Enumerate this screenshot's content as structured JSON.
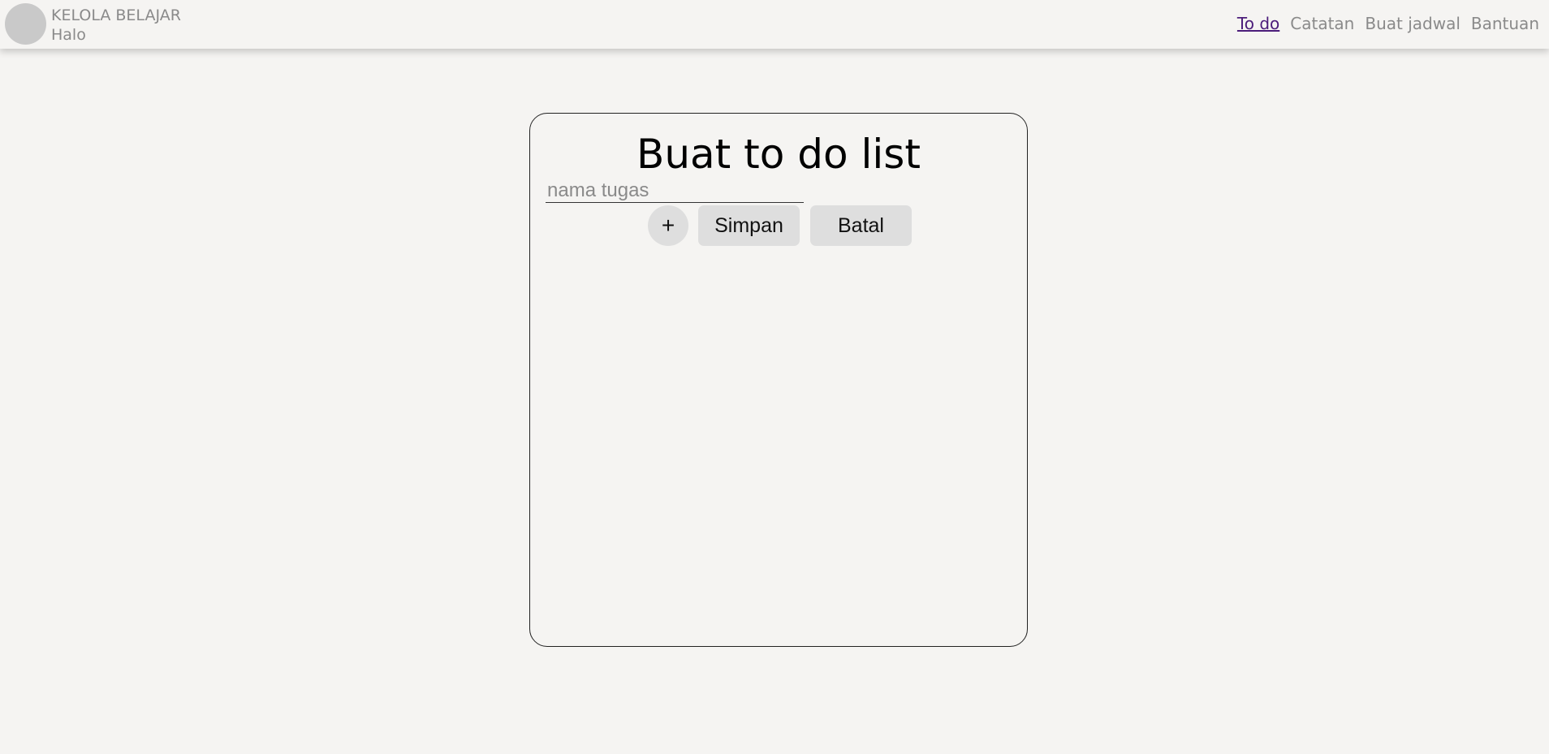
{
  "header": {
    "brand_title": "KELOLA BELAJAR",
    "greeting": "Halo",
    "nav": [
      {
        "label": "To do",
        "active": true
      },
      {
        "label": "Catatan",
        "active": false
      },
      {
        "label": "Buat jadwal",
        "active": false
      },
      {
        "label": "Bantuan",
        "active": false
      }
    ]
  },
  "todo_card": {
    "title": "Buat to do list",
    "input": {
      "placeholder": "nama tugas",
      "value": ""
    },
    "add_label": "+",
    "save_label": "Simpan",
    "cancel_label": "Batal"
  },
  "colors": {
    "background": "#f5f4f2",
    "nav_active": "#4b1c7a",
    "muted_text": "#8a8a8a",
    "button_bg": "#dedede"
  }
}
